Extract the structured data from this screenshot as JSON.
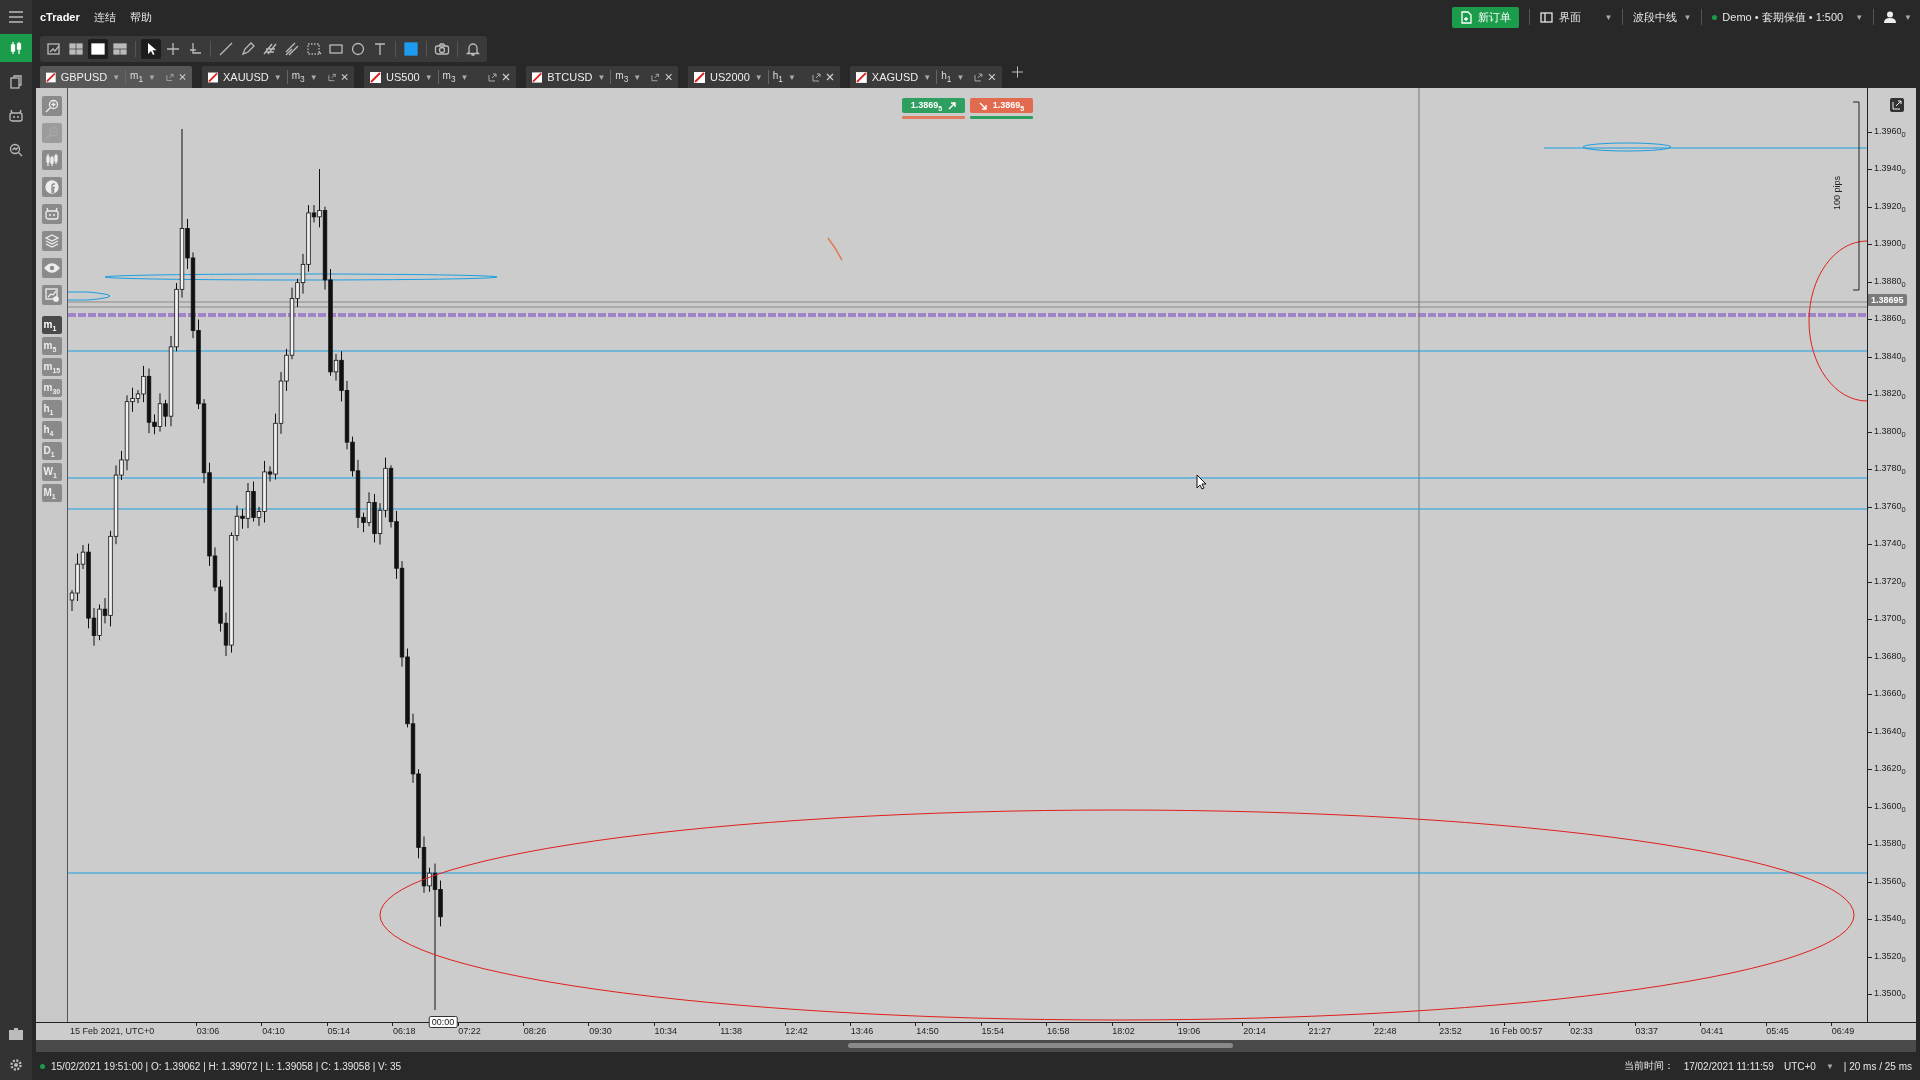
{
  "menu_bar": {
    "app_name": "cTrader",
    "menus": [
      "连结",
      "帮助"
    ],
    "new_order": "新订单",
    "layout": {
      "label": "界面",
      "caret": "▼"
    },
    "workspace": {
      "label": "波段中线",
      "caret": "▼"
    },
    "account": {
      "label": "Demo • 套期保值 • 1:500",
      "caret": "▼",
      "connected": true
    },
    "user_caret": "▼"
  },
  "side_nav": [
    {
      "kind": "chart",
      "selected": true
    },
    {
      "kind": "copy",
      "selected": false
    },
    {
      "kind": "robot",
      "selected": false
    },
    {
      "kind": "analyze",
      "selected": false
    }
  ],
  "toolbar": [
    {
      "kind": "chart-edit",
      "selected": false
    },
    {
      "kind": "four-pane",
      "selected": false
    },
    {
      "kind": "single-pane",
      "selected": true
    },
    {
      "kind": "two-pane",
      "selected": false
    },
    {
      "kind": "pointer",
      "selected": true
    },
    {
      "kind": "crosshair",
      "selected": false
    },
    {
      "kind": "measure",
      "selected": false
    },
    {
      "kind": "line",
      "selected": false
    },
    {
      "kind": "pen",
      "selected": false
    },
    {
      "kind": "fibonacci",
      "selected": false
    },
    {
      "kind": "pitchfork",
      "selected": false
    },
    {
      "kind": "grid",
      "selected": false
    },
    {
      "kind": "rectangle",
      "selected": false
    },
    {
      "kind": "ellipse",
      "selected": false
    },
    {
      "kind": "text",
      "selected": false
    },
    {
      "kind": "color",
      "selected": false
    },
    {
      "kind": "camera",
      "selected": false
    },
    {
      "kind": "bell",
      "selected": false
    }
  ],
  "chart_tabs": [
    {
      "symbol": "GBPUSD",
      "caret": "▼",
      "timeframe": "m$_{1}$",
      "timeframe_caret": "▼",
      "selected": true
    },
    {
      "symbol": "XAUUSD",
      "caret": "▼",
      "timeframe": "m$_{3}$",
      "timeframe_caret": "▼",
      "selected": false
    },
    {
      "symbol": "US500",
      "caret": "▼",
      "timeframe": "m$_{3}$",
      "timeframe_caret": "▼",
      "selected": false
    },
    {
      "symbol": "BTCUSD",
      "caret": "▼",
      "timeframe": "m$_{3}$",
      "timeframe_caret": "▼",
      "selected": false
    },
    {
      "symbol": "US2000",
      "caret": "▼",
      "timeframe": "h$_{1}$",
      "timeframe_caret": "▼",
      "selected": false
    },
    {
      "symbol": "XAGUSD",
      "caret": "▼",
      "timeframe": "h$_{1}$",
      "timeframe_caret": "▼",
      "selected": false
    }
  ],
  "chart_tools": [
    {
      "kind": "zoom-in",
      "disabled": false
    },
    {
      "kind": "zoom-out",
      "disabled": true
    },
    {
      "kind": "candles",
      "disabled": false
    },
    {
      "kind": "share",
      "disabled": false
    },
    {
      "kind": "robot",
      "disabled": false
    },
    {
      "kind": "layers",
      "disabled": false
    },
    {
      "kind": "eye",
      "disabled": false
    },
    {
      "kind": "chart-settings",
      "disabled": false
    }
  ],
  "timeframes": [
    {
      "label": "m$_{1}$",
      "selected": true
    },
    {
      "label": "m$_{5}$",
      "selected": false
    },
    {
      "label": "m$_{15}$",
      "selected": false
    },
    {
      "label": "m$_{30}$",
      "selected": false
    },
    {
      "label": "h$_{1}$",
      "selected": false
    },
    {
      "label": "h$_{4}$",
      "selected": false
    },
    {
      "label": "D$_{1}$",
      "selected": false
    },
    {
      "label": "W$_{1}$",
      "selected": false
    },
    {
      "label": "M$_{1}$",
      "selected": false
    }
  ],
  "chart": {
    "quote_buttons": [
      {
        "kind": "buy",
        "price": "1.3869$_{5}$"
      },
      {
        "kind": "sell",
        "price": "1.3869$_{5}$"
      }
    ],
    "range_label": "100 pips",
    "price_axis": [
      "1.3960$_{0}$",
      "1.3940$_{0}$",
      "1.3920$_{0}$",
      "1.3900$_{0}$",
      "1.3880$_{0}$",
      "1.3860$_{0}$",
      "1.3840$_{0}$",
      "1.3820$_{0}$",
      "1.3800$_{0}$",
      "1.3780$_{0}$",
      "1.3760$_{0}$",
      "1.3740$_{0}$",
      "1.3720$_{0}$",
      "1.3700$_{0}$",
      "1.3680$_{0}$",
      "1.3660$_{0}$",
      "1.3640$_{0}$",
      "1.3620$_{0}$",
      "1.3600$_{0}$",
      "1.3580$_{0}$",
      "1.3560$_{0}$",
      "1.3540$_{0}$",
      "1.3520$_{0}$",
      "1.3500$_{0}$"
    ],
    "current_price": "1.38695",
    "time_axis_start": "15 Feb 2021, UTC+0",
    "time_axis": [
      "03:06",
      "04:10",
      "05:14",
      "06:18",
      "07:22",
      "08:26",
      "09:30",
      "10:34",
      "11:38",
      "12:42",
      "13:46",
      "14:50",
      "15:54",
      "16:58",
      "18:02",
      "19:06",
      "20:14",
      "21:27",
      "22:48",
      "23:52",
      "16 Feb 00:57",
      "02:33",
      "03:37",
      "04:41",
      "05:45",
      "06:49"
    ],
    "time_marker": "00:00"
  },
  "status_bar": {
    "connected": true,
    "bar_info": "15/02/2021 19:51:00 | O: 1.39062 | H: 1.39072 | L: 1.39058 | C: 1.39058 | V: 35",
    "time_label": "当前时间：",
    "time": "17/02/2021 11:11:59",
    "timezone": "UTC+0",
    "timezone_caret": "▼",
    "latency": "| 20 ms / 25 ms"
  }
}
